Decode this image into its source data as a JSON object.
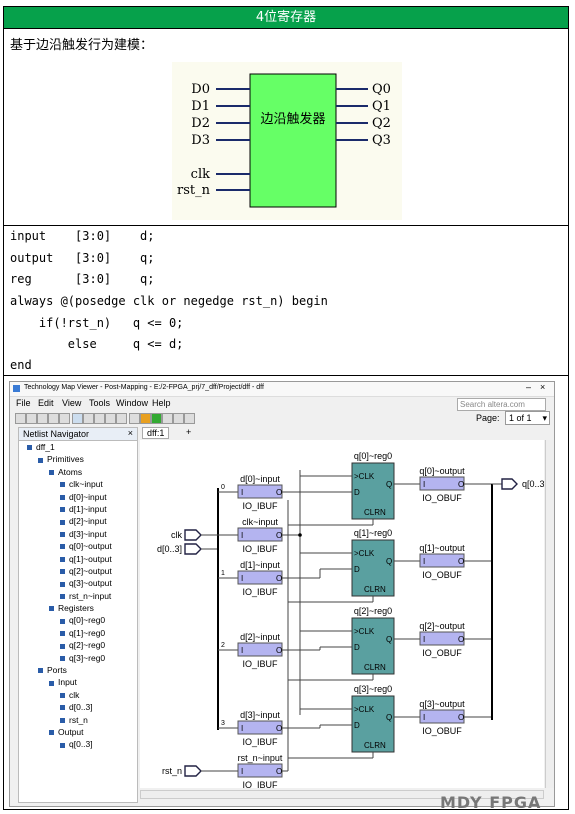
{
  "header": {
    "title": "4位寄存器"
  },
  "symbol_section": {
    "title": "基于边沿触发行为建模：",
    "block_label": "边沿触发器",
    "inputs": [
      "D0",
      "D1",
      "D2",
      "D3",
      "clk",
      "rst_n"
    ],
    "outputs": [
      "Q0",
      "Q1",
      "Q2",
      "Q3"
    ],
    "colors": {
      "block_fill": "#66ff66",
      "block_bg": "#fbfbef"
    }
  },
  "code": {
    "lines": [
      "input    [3:0]    d;",
      "output   [3:0]    q;",
      "reg      [3:0]    q;",
      "always @(posedge clk or negedge rst_n) begin",
      "    if(!rst_n)   q <= 0;",
      "        else     q <= d;",
      "end"
    ]
  },
  "viewer": {
    "window_title": "Technology Map Viewer - Post-Mapping - E:/2-FPGA_prj/7_dff/Project/dff - dff",
    "menu": [
      "File",
      "Edit",
      "View",
      "Tools",
      "Window",
      "Help"
    ],
    "search_placeholder": "Search altera.com",
    "page_label": "Page:",
    "page_value": "1 of 1",
    "navigator": {
      "title": "Netlist Navigator",
      "items": [
        {
          "text": "dff_1",
          "level": 0
        },
        {
          "text": "Primitives",
          "level": 1
        },
        {
          "text": "Atoms",
          "level": 2
        },
        {
          "text": "clk~input",
          "level": 3
        },
        {
          "text": "d[0]~input",
          "level": 3
        },
        {
          "text": "d[1]~input",
          "level": 3
        },
        {
          "text": "d[2]~input",
          "level": 3
        },
        {
          "text": "d[3]~input",
          "level": 3
        },
        {
          "text": "q[0]~output",
          "level": 3
        },
        {
          "text": "q[1]~output",
          "level": 3
        },
        {
          "text": "q[2]~output",
          "level": 3
        },
        {
          "text": "q[3]~output",
          "level": 3
        },
        {
          "text": "rst_n~input",
          "level": 3
        },
        {
          "text": "Registers",
          "level": 2
        },
        {
          "text": "q[0]~reg0",
          "level": 3
        },
        {
          "text": "q[1]~reg0",
          "level": 3
        },
        {
          "text": "q[2]~reg0",
          "level": 3
        },
        {
          "text": "q[3]~reg0",
          "level": 3
        },
        {
          "text": "Ports",
          "level": 1
        },
        {
          "text": "Input",
          "level": 2
        },
        {
          "text": "clk",
          "level": 3
        },
        {
          "text": "d[0..3]",
          "level": 3
        },
        {
          "text": "rst_n",
          "level": 3
        },
        {
          "text": "Output",
          "level": 2
        },
        {
          "text": "q[0..3]",
          "level": 3
        }
      ]
    },
    "tab": "dff:1",
    "schematic": {
      "ports_in": [
        "clk",
        "d[0..3]",
        "rst_n"
      ],
      "port_out": "q[0..3]",
      "bus_indices": [
        "0",
        "1",
        "2",
        "3"
      ],
      "ibufs": [
        {
          "name": "d[0]~input",
          "type": "IO_IBUF"
        },
        {
          "name": "clk~input",
          "type": "IO_IBUF"
        },
        {
          "name": "d[1]~input",
          "type": "IO_IBUF"
        },
        {
          "name": "d[2]~input",
          "type": "IO_IBUF"
        },
        {
          "name": "d[3]~input",
          "type": "IO_IBUF"
        },
        {
          "name": "rst_n~input",
          "type": "IO_IBUF"
        }
      ],
      "regs": [
        "q[0]~reg0",
        "q[1]~reg0",
        "q[2]~reg0",
        "q[3]~reg0"
      ],
      "reg_pins": {
        "clk": ">CLK",
        "d": "D",
        "clrn": "CLRN",
        "q": "Q"
      },
      "obufs": [
        {
          "name": "q[0]~output",
          "type": "IO_OBUF"
        },
        {
          "name": "q[1]~output",
          "type": "IO_OBUF"
        },
        {
          "name": "q[2]~output",
          "type": "IO_OBUF"
        },
        {
          "name": "q[3]~output",
          "type": "IO_OBUF"
        }
      ],
      "pin_i": "I",
      "pin_o": "O",
      "colors": {
        "buf": "#b4b4f0",
        "reg": "#5aa0a0"
      }
    }
  },
  "watermark": "MDY FPGA"
}
